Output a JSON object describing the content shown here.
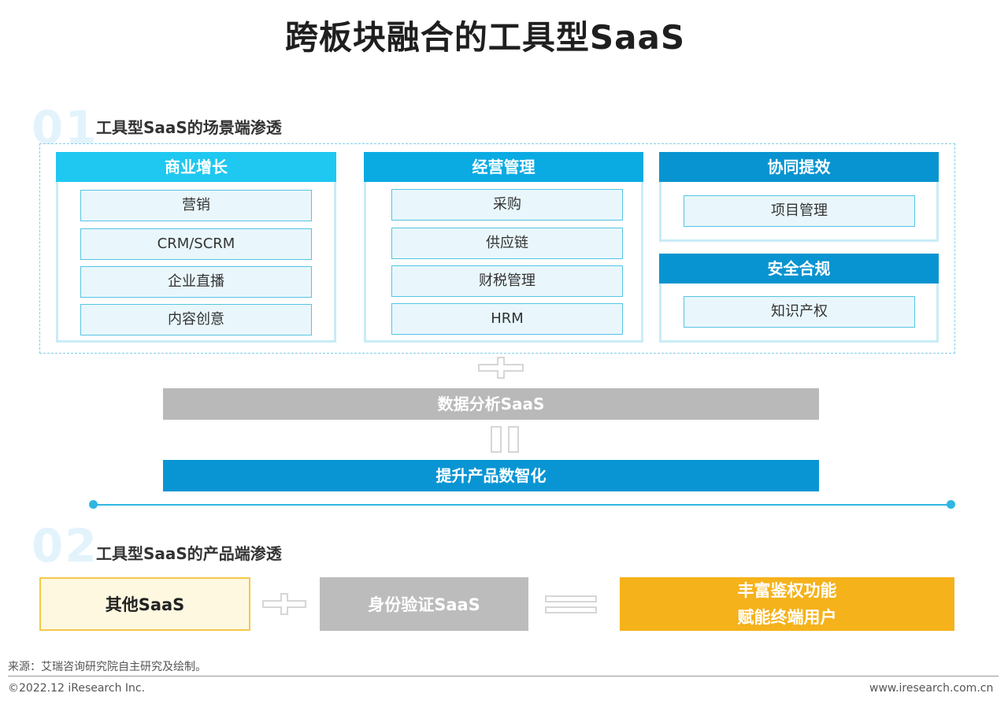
{
  "title": "跨板块融合的工具型SaaS",
  "section1": {
    "number": "01",
    "title": "工具型SaaS的场景端渗透",
    "groups": [
      {
        "name": "商业增长",
        "items": [
          "营销",
          "CRM/SCRM",
          "企业直播",
          "内容创意"
        ]
      },
      {
        "name": "经营管理",
        "items": [
          "采购",
          "供应链",
          "财税管理",
          "HRM"
        ]
      },
      {
        "name": "协同提效",
        "items": [
          "项目管理"
        ]
      },
      {
        "name": "安全合规",
        "items": [
          "知识产权"
        ]
      }
    ],
    "data_analysis_bar": "数据分析SaaS",
    "result_bar": "提升产品数智化"
  },
  "section2": {
    "number": "02",
    "title": "工具型SaaS的产品端渗透",
    "other_box": "其他SaaS",
    "identity_box": "身份验证SaaS",
    "result_line1": "丰富鉴权功能",
    "result_line2": "赋能终端用户"
  },
  "footer": {
    "source": "来源：艾瑞咨询研究院自主研究及绘制。",
    "copyright": "©2022.12 iResearch Inc.",
    "website": "www.iresearch.com.cn"
  },
  "colors": {
    "group1_head": "#1ec8f0",
    "group2_head": "#0aabe3",
    "group3_head": "#0894d0",
    "data_bar": "#b9b9b9",
    "result_bar": "#0995d3",
    "other_box_bg": "#fff8e1",
    "identity_box_bg": "#bcbcbc",
    "result_box_bg": "#f5b21b"
  }
}
